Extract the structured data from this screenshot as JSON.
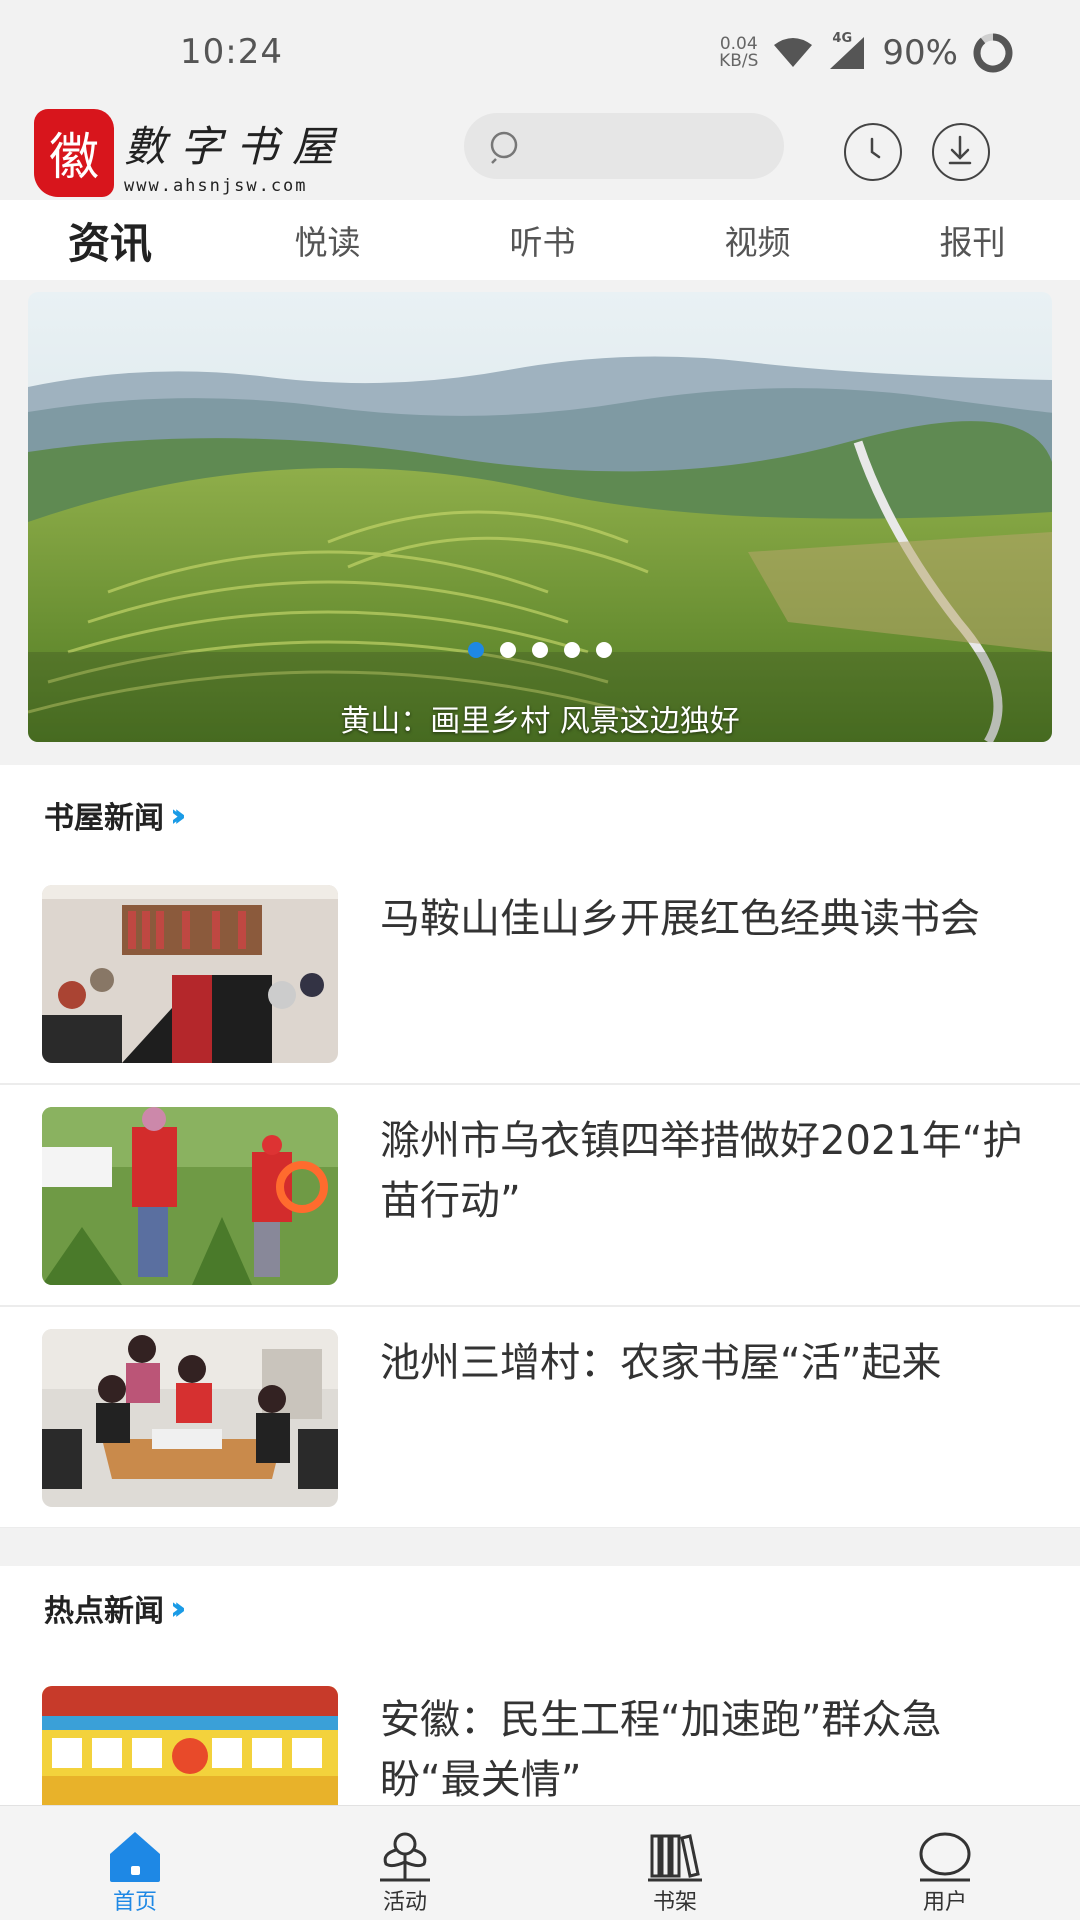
{
  "status_bar": {
    "time": "10:24",
    "net_speed_value": "0.04",
    "net_speed_unit": "KB/S",
    "network": "4G",
    "battery": "90%"
  },
  "header": {
    "logo_seal_char": "徽",
    "logo_name": "數字书屋",
    "logo_url": "www.ahsnjsw.com",
    "icons": [
      "search-icon",
      "history-icon",
      "download-icon"
    ]
  },
  "tabs": [
    {
      "label": "资讯",
      "active": true
    },
    {
      "label": "悦读",
      "active": false
    },
    {
      "label": "听书",
      "active": false
    },
    {
      "label": "视频",
      "active": false
    },
    {
      "label": "报刊",
      "active": false
    }
  ],
  "banner": {
    "caption": "黄山：画里乡村 风景这边独好",
    "slide_count": 5,
    "active_slide": 1
  },
  "sections": [
    {
      "title": "书屋新闻",
      "items": [
        {
          "title": "马鞍山佳山乡开展红色经典读书会"
        },
        {
          "title": "滁州市乌衣镇四举措做好2021年“护苗行动”"
        },
        {
          "title": "池州三增村：农家书屋“活”起来"
        }
      ]
    },
    {
      "title": "热点新闻",
      "items": [
        {
          "title": "安徽：民生工程“加速跑”群众急盼“最关情”"
        }
      ]
    }
  ],
  "bottom_nav": [
    {
      "label": "首页",
      "icon": "home-icon",
      "active": true
    },
    {
      "label": "活动",
      "icon": "activity-icon",
      "active": false
    },
    {
      "label": "书架",
      "icon": "bookshelf-icon",
      "active": false
    },
    {
      "label": "用户",
      "icon": "user-icon",
      "active": false
    }
  ],
  "colors": {
    "accent": "#1e88e5",
    "section_chevron": "#1a9be6",
    "logo_red": "#d8151c",
    "background_gray": "#f2f2f2"
  }
}
